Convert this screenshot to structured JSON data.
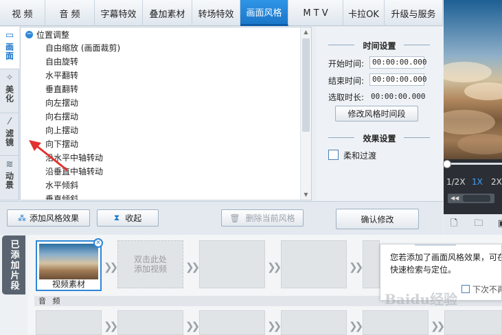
{
  "top_tabs": [
    {
      "label": "视 频",
      "active": false
    },
    {
      "label": "音 频",
      "active": false
    },
    {
      "label": "字幕特效",
      "active": false
    },
    {
      "label": "叠加素材",
      "active": false
    },
    {
      "label": "转场特效",
      "active": false
    },
    {
      "label": "画面风格",
      "active": true
    },
    {
      "label": "M T V",
      "active": false
    },
    {
      "label": "卡拉OK",
      "active": false
    },
    {
      "label": "升级与服务",
      "active": false
    }
  ],
  "side_tabs": [
    {
      "label": "画面",
      "icon": "film-icon",
      "active": true
    },
    {
      "label": "美化",
      "icon": "wand-icon",
      "active": false
    },
    {
      "label": "滤镜",
      "icon": "sparkle-wand-icon",
      "active": false
    },
    {
      "label": "动景",
      "icon": "wave-icon",
      "active": false
    }
  ],
  "style_list": {
    "group": "位置调整",
    "items": [
      "自由缩放 (画面裁剪)",
      "自由旋转",
      "水平翻转",
      "垂直翻转",
      "向左摆动",
      "向右摆动",
      "向上摆动",
      "向下摆动",
      "沿水平中轴转动",
      "沿垂直中轴转动",
      "水平倾斜",
      "垂直倾斜"
    ]
  },
  "settings": {
    "time_title": "时间设置",
    "start_label": "开始时间:",
    "start_value": "00:00:00.000",
    "end_label": "结束时间:",
    "end_value": "00:00:00.000",
    "duration_label": "选取时长:",
    "duration_value": "00:00:00.000",
    "modify_time_btn": "修改风格时间段",
    "effect_title": "效果设置",
    "smooth_label": "柔和过渡",
    "smooth_checked": false
  },
  "toolbar": {
    "add_effect": "添加风格效果",
    "collapse": "收起",
    "delete_style": "删除当前风格",
    "confirm": "确认修改"
  },
  "player": {
    "speeds": [
      "1/2X",
      "1X",
      "2X"
    ],
    "active_speed": "1X"
  },
  "timeline": {
    "side_tab": "已添加片段",
    "clip_caption": "视频素材",
    "add_video_hint_1": "双击此处",
    "add_video_hint_2": "添加视频",
    "audio_label": "音 频"
  },
  "tooltip": {
    "line1": "您若添加了画面风格效果，可在",
    "line2": "快速检索与定位。",
    "dont_show": "下次不再"
  },
  "watermark": "Baidu经验"
}
